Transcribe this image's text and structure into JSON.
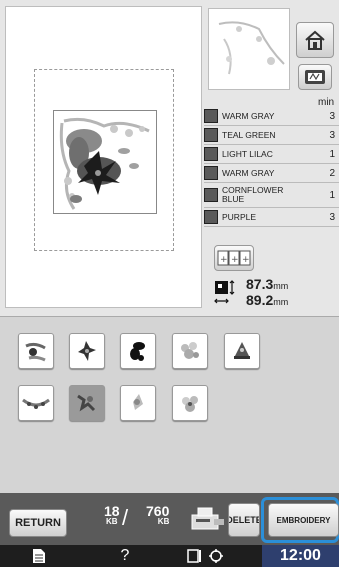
{
  "threads": {
    "min_header": "min",
    "items": [
      {
        "name": "WARM GRAY",
        "minutes": "3"
      },
      {
        "name": "TEAL GREEN",
        "minutes": "3"
      },
      {
        "name": "LIGHT LILAC",
        "minutes": "1"
      },
      {
        "name": "WARM GRAY",
        "minutes": "2"
      },
      {
        "name": "CORNFLOWER BLUE",
        "minutes": "1"
      },
      {
        "name": "PURPLE",
        "minutes": "3"
      }
    ]
  },
  "size": {
    "height": "87.3",
    "width": "89.2",
    "unit": "mm"
  },
  "bottom": {
    "return_label": "RETURN",
    "memory_used": "18",
    "memory_total": "760",
    "memory_unit": "KB",
    "slash": "/",
    "delete_label": "DELETE",
    "embroidery_label": "EMBROIDERY"
  },
  "status": {
    "help": "?",
    "time": "12:00"
  },
  "colors": {
    "highlight": "#2b8fd8",
    "clock_bg": "#2e3f6e"
  }
}
